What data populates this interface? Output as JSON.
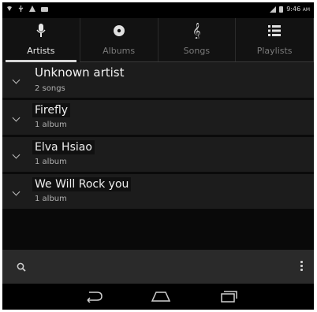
{
  "status_bar": {
    "time": "9:46",
    "time_suffix": "AM",
    "left_icons": [
      "wifi-icon",
      "usb-icon",
      "warning-icon",
      "photo-icon"
    ],
    "right_icons": [
      "signal-icon",
      "battery-icon"
    ]
  },
  "tabs": [
    {
      "label": "Artists",
      "icon": "microphone-icon",
      "active": true
    },
    {
      "label": "Albums",
      "icon": "disc-icon",
      "active": false
    },
    {
      "label": "Songs",
      "icon": "treble-clef-icon",
      "active": false
    },
    {
      "label": "Playlists",
      "icon": "list-icon",
      "active": false
    }
  ],
  "artists": [
    {
      "name": "Unknown artist",
      "detail": "2 songs"
    },
    {
      "name": "Firefly",
      "detail": "1 album"
    },
    {
      "name": "Elva Hsiao",
      "detail": "1 album"
    },
    {
      "name": "We Will Rock you",
      "detail": "1 album"
    }
  ],
  "bottom_bar": {
    "left_icon": "search-icon",
    "right_icon": "overflow-menu-icon"
  },
  "nav_bar": {
    "buttons": [
      "back-icon",
      "home-icon",
      "recent-apps-icon"
    ]
  },
  "colors": {
    "background": "#0a0a0a",
    "row": "#1c1c1c",
    "active_tab_indicator": "#d6d6d6"
  }
}
